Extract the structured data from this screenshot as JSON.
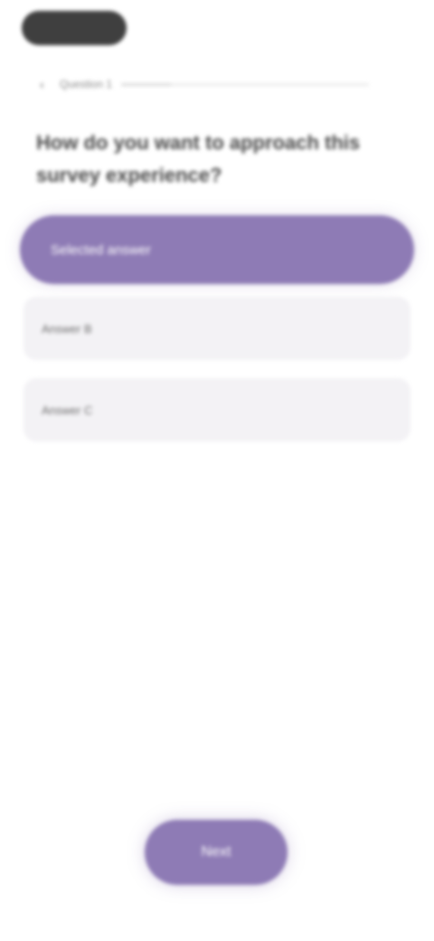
{
  "header": {
    "back_icon": "chevron-left-icon",
    "progress_label": "Question 1",
    "progress_value": 0.2
  },
  "question": {
    "text": "How do you want to approach this survey experience?"
  },
  "options": [
    {
      "label": "Selected answer",
      "selected": true
    },
    {
      "label": "Answer B",
      "selected": false
    },
    {
      "label": "Answer C",
      "selected": false
    }
  ],
  "footer": {
    "next_label": "Next"
  },
  "colors": {
    "accent": "#8e7bb5",
    "option_bg": "#f3f2f5",
    "pill": "#3f3f3f"
  }
}
